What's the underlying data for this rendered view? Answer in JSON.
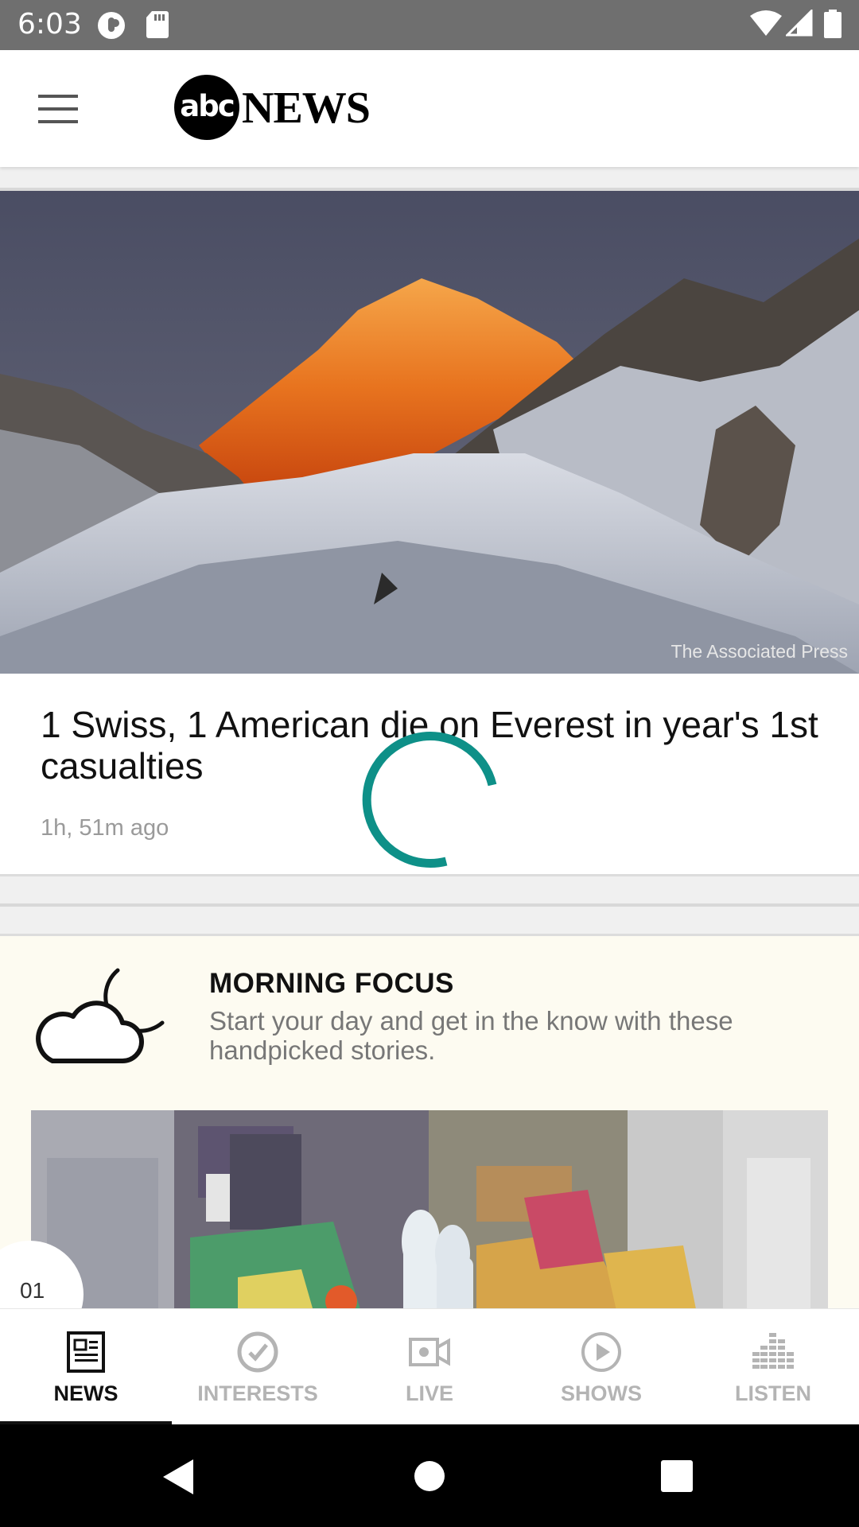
{
  "status_bar": {
    "time": "6:03"
  },
  "app": {
    "brand_abc": "abc",
    "brand_news": "NEWS"
  },
  "hero": {
    "photo_credit": "The Associated Press",
    "title": "1 Swiss, 1 American die on Everest in year's 1st casualties",
    "time_ago": "1h, 51m ago"
  },
  "morning_focus": {
    "title": "MORNING FOCUS",
    "description": "Start your day and get in the know with these handpicked stories.",
    "slide_index": "01"
  },
  "bottom_nav": {
    "tabs": [
      {
        "label": "NEWS",
        "icon": "news-icon",
        "active": true
      },
      {
        "label": "INTERESTS",
        "icon": "interests-check-icon",
        "active": false
      },
      {
        "label": "LIVE",
        "icon": "live-video-icon",
        "active": false
      },
      {
        "label": "SHOWS",
        "icon": "shows-play-icon",
        "active": false
      },
      {
        "label": "LISTEN",
        "icon": "listen-equalizer-icon",
        "active": false
      }
    ]
  },
  "colors": {
    "spinner": "#0e9088",
    "status_bar": "#6f6f6f",
    "active_tab": "#111111",
    "inactive_tab": "#b4b4b4",
    "focus_bg": "#fdfbf1"
  }
}
